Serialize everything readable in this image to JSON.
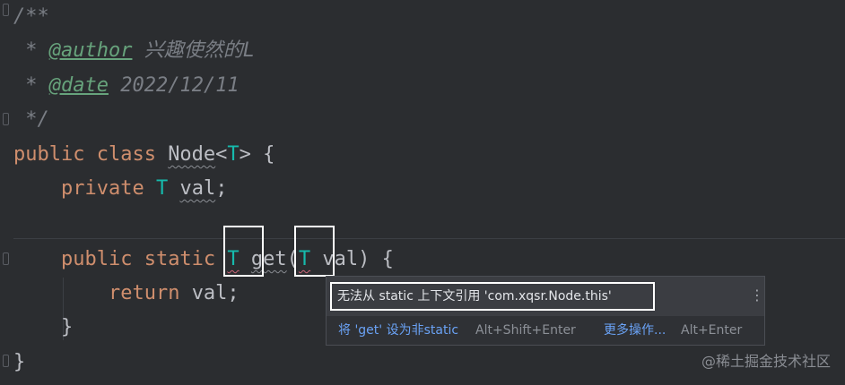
{
  "editor": {
    "lines": {
      "l1": "/**",
      "l2_star": " * ",
      "l2_tag": "@author",
      "l2_text": " 兴趣使然的L",
      "l3_star": " * ",
      "l3_tag": "@date",
      "l3_text": " 2022/12/11",
      "l4": " */",
      "l5_kw": "public class ",
      "l5_cls": "Node",
      "l5_lt": "<",
      "l5_T": "T",
      "l5_rest": "> {",
      "l6_indent": "    ",
      "l6_kw": "private ",
      "l6_T": "T",
      "l6_sp": " ",
      "l6_val": "val",
      "l6_end": ";",
      "l8_indent": "    ",
      "l8_kw": "public static ",
      "l8_T": "T",
      "l8_sp": " ",
      "l8_get": "get",
      "l8_paren": "(",
      "l8_T2": "T",
      "l8_rest": " val) {",
      "l9_indent": "        ",
      "l9_kw": "return ",
      "l9_rest": "val;",
      "l10": "    }",
      "l11": "}"
    }
  },
  "popup": {
    "message": "无法从 static 上下文引用 'com.xqsr.Node.this'",
    "more_icon": "kebab-menu-icon",
    "action_label": "将 'get' 设为非static",
    "action_shortcut": "Alt+Shift+Enter",
    "more_actions_label": "更多操作...",
    "more_actions_shortcut": "Alt+Enter"
  },
  "watermark": "@稀土掘金技术社区",
  "colors": {
    "background": "#2b2d30",
    "keyword": "#cf8e6d",
    "type_param": "#16baac",
    "doc_comment": "#7a7e85",
    "doc_tag": "#67a37c",
    "action_link": "#6aa2f5"
  }
}
